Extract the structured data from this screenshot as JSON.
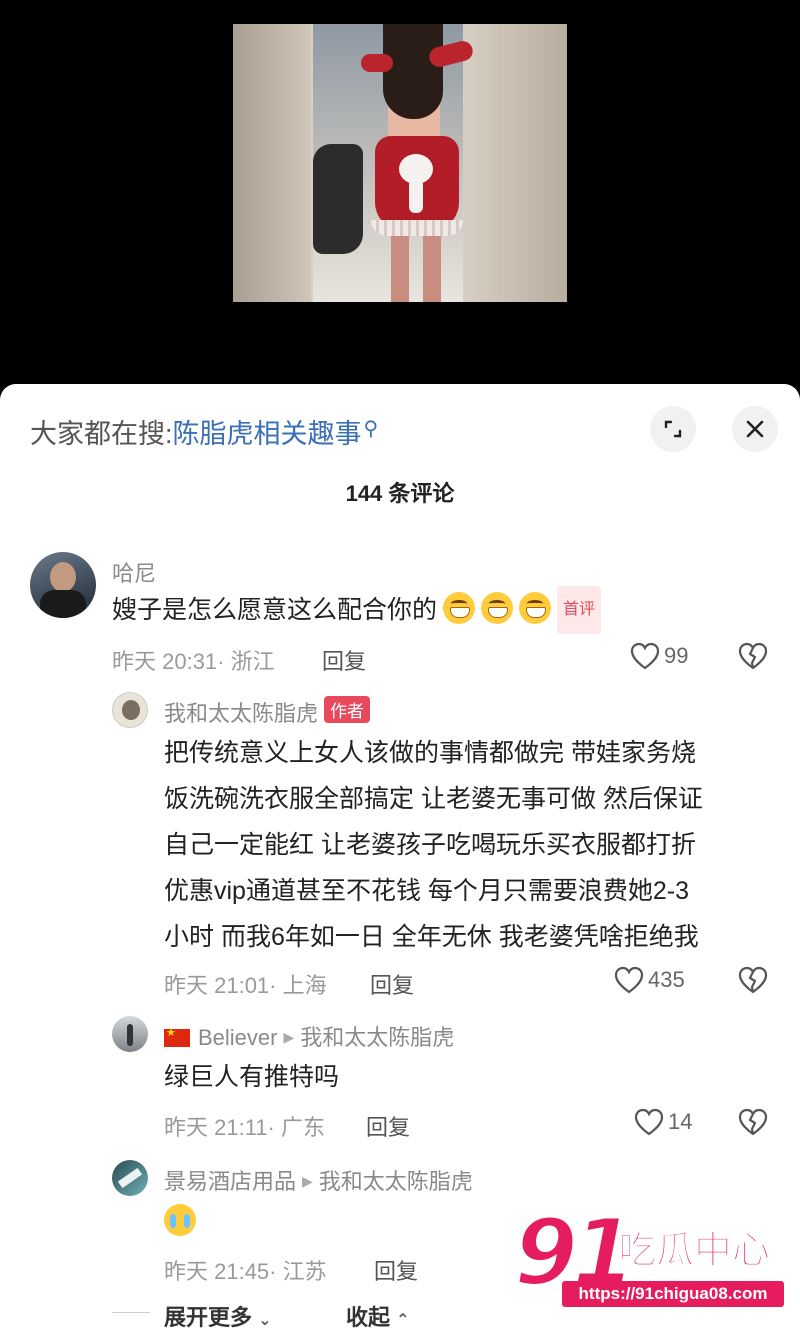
{
  "search": {
    "prefix": "大家都在搜:",
    "query": "陈脂虎相关趣事",
    "icon": "search-icon"
  },
  "header": {
    "count": "144 条评论"
  },
  "comments": [
    {
      "user": "哈尼",
      "text": "嫂子是怎么愿意这么配合你的",
      "tag": "首评",
      "time": "昨天 20:31· 浙江",
      "reply": "回复",
      "likes": "99"
    },
    {
      "user": "我和太太陈脂虎",
      "tag": "作者",
      "lines": [
        "把传统意义上女人该做的事情都做完 带娃家务烧",
        "饭洗碗洗衣服全部搞定 让老婆无事可做 然后保证",
        "自己一定能红 让老婆孩子吃喝玩乐买衣服都打折",
        "优惠vip通道甚至不花钱 每个月只需要浪费她2-3",
        "小时 而我6年如一日 全年无休 我老婆凭啥拒绝我"
      ],
      "time": "昨天 21:01· 上海",
      "reply": "回复",
      "likes": "435"
    },
    {
      "user": "Believer",
      "reply_to": "我和太太陈脂虎",
      "text": "绿巨人有推特吗",
      "time": "昨天 21:11· 广东",
      "reply": "回复",
      "likes": "14"
    },
    {
      "user": "景易酒店用品",
      "reply_to": "我和太太陈脂虎",
      "time": "昨天 21:45· 江苏",
      "reply": "回复"
    }
  ],
  "footer": {
    "expand": "展开更多",
    "collapse": "收起"
  },
  "watermark": {
    "number": "91",
    "name": "吃瓜中心",
    "url": "https://91chigua08.com"
  },
  "colors": {
    "link": "#3b6fb6",
    "accent": "#e94a5b",
    "watermark": "#e51c5e"
  }
}
